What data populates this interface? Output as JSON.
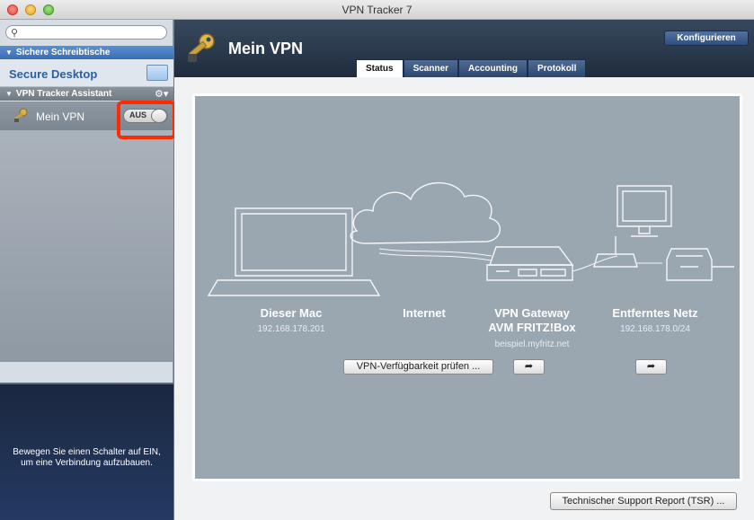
{
  "window": {
    "title": "VPN Tracker 7"
  },
  "sidebar": {
    "search_placeholder": "",
    "section_desktops": "Sichere Schreibtische",
    "desktop_item": "Secure Desktop",
    "section_assistant": "VPN Tracker Assistant",
    "vpn_item": {
      "label": "Mein VPN",
      "toggle_state": "AUS"
    },
    "hint": "Bewegen Sie einen Schalter auf EIN, um eine Verbindung aufzubauen."
  },
  "main": {
    "title": "Mein VPN",
    "config_button": "Konfigurieren",
    "tabs": [
      {
        "label": "Status",
        "active": true
      },
      {
        "label": "Scanner",
        "active": false
      },
      {
        "label": "Accounting",
        "active": false
      },
      {
        "label": "Protokoll",
        "active": false
      }
    ],
    "diagram": {
      "mac": {
        "title": "Dieser Mac",
        "ip": "192.168.178.201"
      },
      "internet": {
        "title": "Internet"
      },
      "gateway": {
        "title": "VPN Gateway",
        "model": "AVM FRITZ!Box",
        "host": "beispiel.myfritz.net"
      },
      "remote": {
        "title": "Entferntes Netz",
        "subnet": "192.168.178.0/24"
      },
      "check_button": "VPN-Verfügbarkeit prüfen ..."
    },
    "tsr_button": "Technischer Support Report (TSR) ..."
  },
  "colors": {
    "highlight": "#ff2a00",
    "stage": "#9aa6b0",
    "sidebar_selection": "#8f99a3"
  }
}
